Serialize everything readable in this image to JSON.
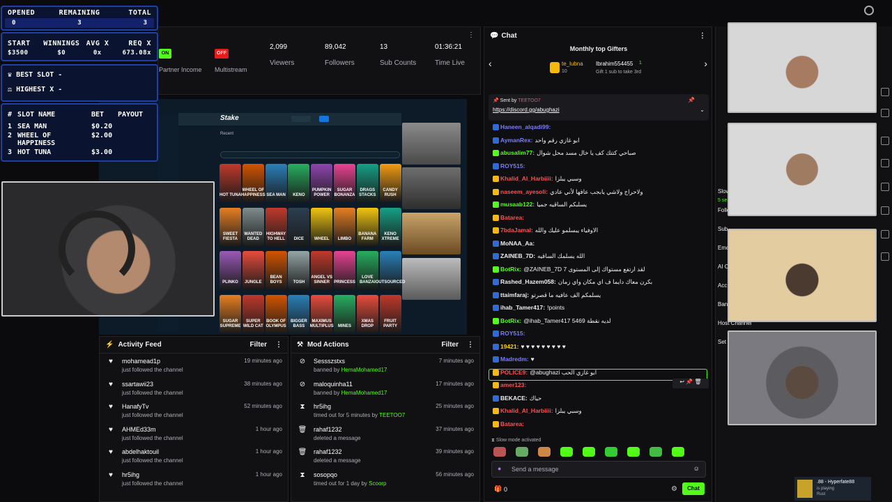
{
  "overlay": {
    "opened_headers": [
      "OPENED",
      "REMAINING",
      "TOTAL"
    ],
    "opened_values": [
      "0",
      "3",
      "3"
    ],
    "stats_headers": [
      "START",
      "WINNINGS",
      "AVG X",
      "REQ X"
    ],
    "stats_values": [
      "$3500",
      "$0",
      "0x",
      "673.08x"
    ],
    "best_slot": "BEST SLOT -",
    "highest_x": "HIGHEST X -",
    "slot_headers": [
      "#",
      "SLOT NAME",
      "BET",
      "PAYOUT"
    ],
    "slots": [
      {
        "n": "1",
        "name": "SEA MAN",
        "bet": "$0.20",
        "payout": ""
      },
      {
        "n": "2",
        "name": "WHEEL OF HAPPINESS",
        "bet": "$2.00",
        "payout": ""
      },
      {
        "n": "3",
        "name": "HOT TUNA",
        "bet": "$3.00",
        "payout": ""
      }
    ]
  },
  "dashboard": {
    "partner_on": "ON",
    "partner_label": "Partner Income",
    "multistream_off": "OFF",
    "multistream_label": "Multistream",
    "viewers": "2,099",
    "viewers_label": "Viewers",
    "followers": "89,042",
    "followers_label": "Followers",
    "subs": "13",
    "subs_label": "Sub Counts",
    "time_live": "01:36:21",
    "time_live_label": "Time Live"
  },
  "stake": {
    "logo": "Stake",
    "recent": "Recent",
    "games": [
      "HOT TUNA",
      "WHEEL OF HAPPINESS",
      "SEA MAN",
      "KENO",
      "PUMPKIN POWER",
      "SUGAR BONANZA",
      "DRAGS STACKS",
      "CANDY RUSH",
      "SWEET FIESTA",
      "WANTED DEAD",
      "HIGHWAY TO HELL",
      "DICE",
      "WHEEL",
      "LIMBO",
      "BANANA FARM",
      "KENO XTREME",
      "PLINKO",
      "JUNGLE",
      "BEAN BOYS",
      "TOSH",
      "ANGEL VS SINNER",
      "PRINCESS",
      "LOVE BANZAI",
      "OUTSOURCED",
      "SUGAR SUPREME",
      "SUPER WILD CAT",
      "BOOK OF OLYMPUS",
      "BIGGER BASS",
      "MAXIMUS MULTIPLUS",
      "MINES",
      "XMAS DROP",
      "FRUIT PARTY"
    ]
  },
  "activity": {
    "title": "Activity Feed",
    "filter": "Filter",
    "items": [
      {
        "name": "mohamead1p",
        "text": "just followed the channel",
        "time": "19 minutes ago"
      },
      {
        "name": "ssartawii23",
        "text": "just followed the channel",
        "time": "38 minutes ago"
      },
      {
        "name": "HanafyTv",
        "text": "just followed the channel",
        "time": "52 minutes ago"
      },
      {
        "name": "AHMEd33m",
        "text": "just followed the channel",
        "time": "1 hour ago"
      },
      {
        "name": "abdelhaktouil",
        "text": "just followed the channel",
        "time": "1 hour ago"
      },
      {
        "name": "hr5ihg",
        "text": "just followed the channel",
        "time": "1 hour ago"
      }
    ]
  },
  "mod": {
    "title": "Mod Actions",
    "filter": "Filter",
    "items": [
      {
        "name": "Sessszstxs",
        "text": "banned by",
        "by": "HemaMohamed17",
        "time": "7 minutes ago",
        "icon": "⊘"
      },
      {
        "name": "maloquinha11",
        "text": "banned by",
        "by": "HemaMohamed17",
        "time": "17 minutes ago",
        "icon": "⊘"
      },
      {
        "name": "hr5ihg",
        "text": "timed out for 5 minutes by",
        "by": "TEETOO7",
        "time": "25 minutes ago",
        "icon": "⧗"
      },
      {
        "name": "rahaf1232",
        "text": "deleted a message",
        "by": "",
        "time": "37 minutes ago",
        "icon": "🗑"
      },
      {
        "name": "rahaf1232",
        "text": "deleted a message",
        "by": "",
        "time": "39 minutes ago",
        "icon": "🗑"
      },
      {
        "name": "sosopqo",
        "text": "timed out for 1 day by",
        "by": "Scoorp",
        "time": "56 minutes ago",
        "icon": "⧗"
      }
    ]
  },
  "chat": {
    "title": "Chat",
    "gifters_title": "Monthly top Gifters",
    "gifter1": "te_lubna",
    "gifter1_count": "10",
    "gifter2": "Ibrahim554455",
    "gifter2_count": "1",
    "gifter2_note": "Gift 1 sub to take 3rd",
    "pinned_sent_by": "Sent by",
    "pinned_user": "TEETOO7",
    "pinned_link": "https://discord.gg/abughazi",
    "lines": [
      {
        "u": "Haneen_alqadi99:",
        "c": "#7b7bff",
        "m": ""
      },
      {
        "u": "AymanRex:",
        "c": "#7b7bff",
        "m": "ابو غازي رقم واحد"
      },
      {
        "u": "abusalim77:",
        "c": "#53fc18",
        "m": "صباحي كتتك كف يا خال مسد محل شوال"
      },
      {
        "u": "ROY515:",
        "c": "#7b7bff",
        "m": ""
      },
      {
        "u": "Khalid_Al_Harbiiii:",
        "c": "#ff4f4f",
        "m": "وسبي يبلزا"
      },
      {
        "u": "naseem_ayesoli:",
        "c": "#ff4f4f",
        "m": "ولاحراج ولاشي يابجب عافها لأني عادي"
      },
      {
        "u": "musaab122:",
        "c": "#53fc18",
        "m": "يسلبكم الساقيه جميا"
      },
      {
        "u": "Batarea:",
        "c": "#ff4f4f",
        "m": ""
      },
      {
        "u": "7bdaJamal:",
        "c": "#ff4f4f",
        "m": "الاوفياء يبسلمو عليك والله"
      },
      {
        "u": "MoNAA_Aa:",
        "c": "#efeff1",
        "m": ""
      },
      {
        "u": "ZAINEB_7D:",
        "c": "#efeff1",
        "m": "الله يسلمك الساقيه"
      },
      {
        "u": "BotRix:",
        "c": "#53fc18",
        "m": "@ZAINEB_7D 7 لقد ارتفع مستواك إلى المستوى"
      },
      {
        "u": "Rashed_Hazem058:",
        "c": "#efeff1",
        "m": "بكرن معاك دايما ف اي مكان واي زمان"
      },
      {
        "u": "ttaimfaraj:",
        "c": "#efeff1",
        "m": "يسلمكم الف عافيه ما قصرتو"
      },
      {
        "u": "ihab_Tamer417:",
        "c": "#efeff1",
        "m": "!points"
      },
      {
        "u": "BotRix:",
        "c": "#53fc18",
        "m": "@ihab_Tamer417 5469 لديه نقطة"
      },
      {
        "u": "ROY515:",
        "c": "#7b7bff",
        "m": ""
      },
      {
        "u": "19421:",
        "c": "#ffd400",
        "m": "♥ ♥ ♥ ♥ ♥ ♥ ♥ ♥ ♥"
      },
      {
        "u": "Madredm:",
        "c": "#7b7bff",
        "m": "♥"
      },
      {
        "u": "POLICE9:",
        "c": "#ff4f4f",
        "m": "@abughazi ابو غازي الحب"
      },
      {
        "u": "amer123:",
        "c": "#ff4f4f",
        "m": ""
      },
      {
        "u": "BEKACE:",
        "c": "#efeff1",
        "m": "حياك"
      },
      {
        "u": "Khalid_Al_Harbiiii:",
        "c": "#ff4f4f",
        "m": "وسبي يبلزا"
      },
      {
        "u": "Batarea:",
        "c": "#ff4f4f",
        "m": ""
      }
    ],
    "slow_mode": "Slow mode activated",
    "placeholder": "Send a message",
    "points": "0",
    "send": "Chat"
  },
  "right_panel": {
    "items": [
      "Slow",
      "Followers-only chat",
      "Sub",
      "Emo",
      "AI C",
      "Acc",
      "Ban",
      "Host Channel",
      "Set"
    ],
    "slow_sub": "5 se"
  },
  "notification": {
    "title": ".88 - Hyperfate88",
    "subtitle": "is playing",
    "game": "Rust"
  }
}
